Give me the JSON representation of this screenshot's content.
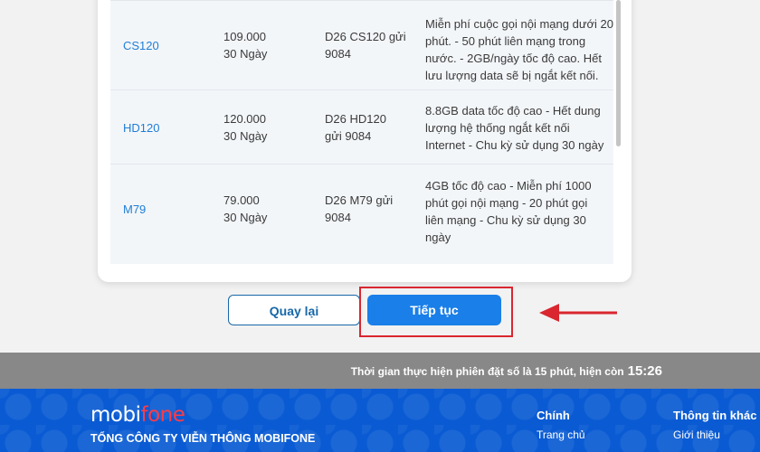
{
  "table": {
    "rows": [
      {
        "code": "",
        "price": "",
        "duration": "",
        "syntax": [],
        "description": [
          "",
          "",
          "",
          ""
        ]
      },
      {
        "code": "CS120",
        "price": "109.000",
        "duration": "30 Ngày",
        "syntax": [
          "D26 CS120 gửi",
          "9084"
        ],
        "description": [
          "Miễn phí cuộc gọi nội mạng dưới 20",
          "phút. - 50 phút liên mạng trong",
          "nước. - 2GB/ngày tốc độ cao. Hết",
          "lưu lượng data sẽ bị ngắt kết nối."
        ]
      },
      {
        "code": "HD120",
        "price": "120.000",
        "duration": "30 Ngày",
        "syntax": [
          "D26 HD120",
          "gửi 9084"
        ],
        "description": [
          "8.8GB data tốc độ cao - Hết dung",
          "lượng hệ thống ngắt kết nối",
          "Internet - Chu kỳ sử dụng 30 ngày"
        ]
      },
      {
        "code": "M79",
        "price": "79.000",
        "duration": "30 Ngày",
        "syntax": [
          "D26 M79 gửi",
          "9084"
        ],
        "description": [
          "4GB tốc độ cao - Miễn phí 1000",
          "phút gọi nội mạng - 20 phút gọi",
          "liên mạng - Chu kỳ sử dụng 30",
          "ngày"
        ]
      }
    ]
  },
  "buttons": {
    "back_label": "Quay lại",
    "next_label": "Tiếp tục"
  },
  "timer": {
    "message": "Thời gian thực hiện phiên đặt số là 15 phút, hiện còn",
    "remaining": "15:26"
  },
  "footer": {
    "logo_main": "mobi",
    "logo_accent": "fone",
    "company": "TỔNG CÔNG TY VIỄN THÔNG MOBIFONE",
    "col1_title": "Chính",
    "col1_items": [
      "Trang chủ"
    ],
    "col2_title": "Thông tin khác",
    "col2_items": [
      "Giới thiệu"
    ]
  },
  "colors": {
    "primary": "#1a7fe8",
    "highlight": "#d9262f",
    "footer": "#0a5bd3"
  }
}
